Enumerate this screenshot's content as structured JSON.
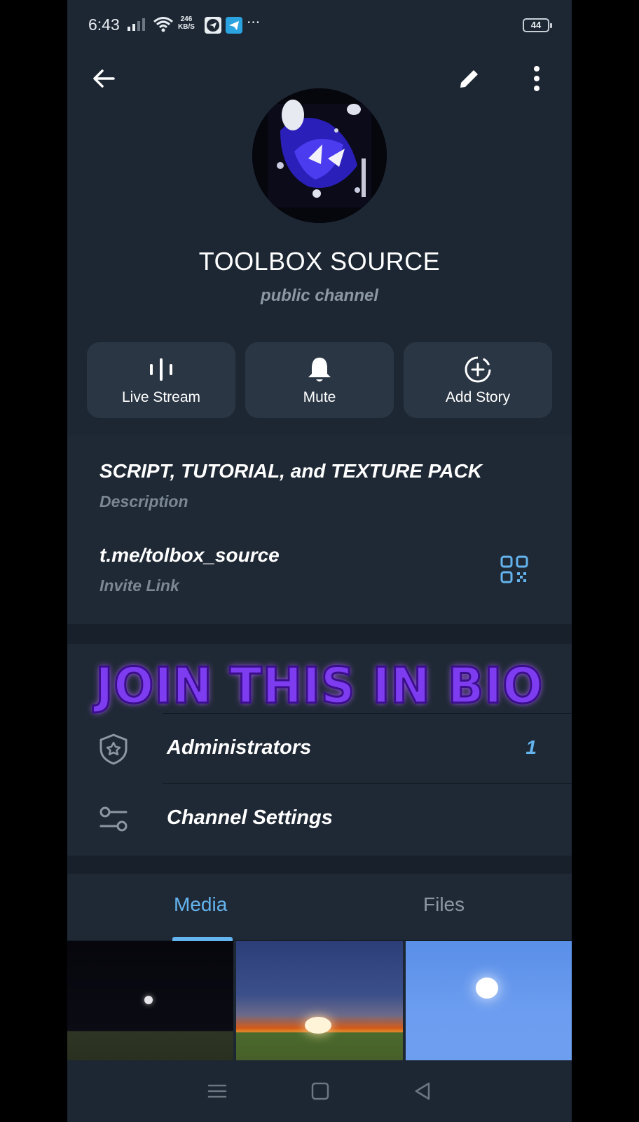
{
  "status_bar": {
    "time": "6:43",
    "net_speed_value": "246",
    "net_speed_unit": "KB/S",
    "overflow": "···",
    "battery": "44"
  },
  "header": {
    "back_icon": "arrow-left-icon",
    "edit_icon": "pencil-icon",
    "more_icon": "more-vertical-icon"
  },
  "channel": {
    "title": "TOOLBOX SOURCE",
    "subtitle": "public channel"
  },
  "actions": [
    {
      "label": "Live Stream",
      "icon": "live-stream-icon"
    },
    {
      "label": "Mute",
      "icon": "bell-icon"
    },
    {
      "label": "Add Story",
      "icon": "add-story-icon"
    }
  ],
  "info": {
    "description": "SCRIPT, TUTORIAL, and TEXTURE PACK",
    "description_label": "Description",
    "invite_link": "t.me/tolbox_source",
    "invite_link_label": "Invite Link"
  },
  "overlay_banner": "JOIN THIS IN BIO",
  "manage": {
    "administrators_label": "Administrators",
    "administrators_count": "1",
    "settings_label": "Channel Settings"
  },
  "tabs": {
    "media": "Media",
    "files": "Files",
    "active": "Media"
  },
  "colors": {
    "background": "#1d2733",
    "card": "#2a3644",
    "accent": "#64b4ef",
    "banner": "#7e3cf0"
  }
}
